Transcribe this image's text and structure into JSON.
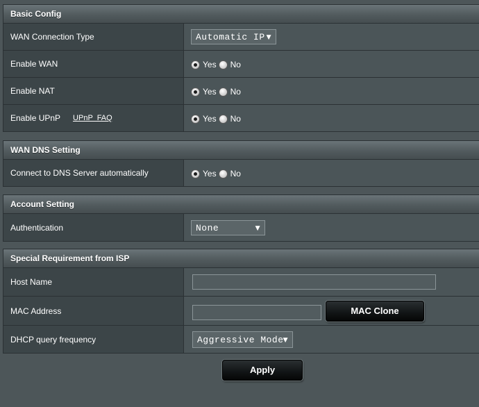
{
  "basic_config": {
    "header": "Basic Config",
    "wan_type_label": "WAN Connection Type",
    "wan_type_value": "Automatic IP",
    "enable_wan_label": "Enable WAN",
    "enable_nat_label": "Enable NAT",
    "enable_upnp_label": "Enable UPnP",
    "upnp_faq_link": "UPnP  FAQ",
    "yes": "Yes",
    "no": "No",
    "enable_wan_selected": "Yes",
    "enable_nat_selected": "Yes",
    "enable_upnp_selected": "Yes"
  },
  "wan_dns": {
    "header": "WAN DNS Setting",
    "dns_auto_label": "Connect to DNS Server automatically",
    "dns_auto_selected": "Yes"
  },
  "account": {
    "header": "Account Setting",
    "auth_label": "Authentication",
    "auth_value": "None"
  },
  "isp": {
    "header": "Special Requirement from ISP",
    "host_name_label": "Host Name",
    "host_name_value": "",
    "mac_label": "MAC Address",
    "mac_value": "",
    "mac_clone_button": "MAC Clone",
    "dhcp_label": "DHCP query frequency",
    "dhcp_value": "Aggressive Mode"
  },
  "apply_button": "Apply",
  "icons": {
    "dropdown": "triangle-down-icon",
    "radio": "radio-button-icon"
  }
}
